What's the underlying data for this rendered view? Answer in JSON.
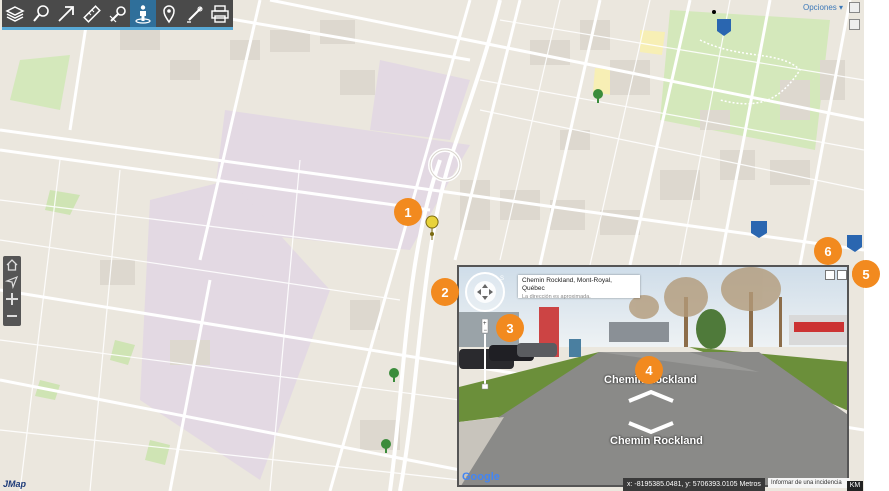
{
  "toolbar": {
    "tools": [
      {
        "icon": "layers-icon",
        "active": false
      },
      {
        "icon": "search-icon",
        "active": false
      },
      {
        "icon": "arrow-upright-icon",
        "active": false
      },
      {
        "icon": "measure-icon",
        "active": false
      },
      {
        "icon": "select-icon",
        "active": false
      },
      {
        "icon": "street-view-icon",
        "active": true
      },
      {
        "icon": "pin-icon",
        "active": false
      },
      {
        "icon": "draw-icon",
        "active": false
      },
      {
        "icon": "print-icon",
        "active": false
      }
    ]
  },
  "nav": {
    "items": [
      "home-icon",
      "locate-icon",
      "zoom-in-icon",
      "zoom-out-icon"
    ]
  },
  "options_label": "Opciones ▾",
  "brand": "JMap",
  "scale_unit": "KM",
  "status": {
    "coords": "x: -8195385.0481, y: 5706393.0105 Metros",
    "report": "Informar de una incidencia"
  },
  "streetview": {
    "address": "Chemin Rockland, Mont-Royal, Québec",
    "approx_note": "La dirección es aproximada.",
    "road_label_far": "Chemin Rockland",
    "road_label_near": "Chemin Rockland",
    "google_logo": "Google"
  },
  "callouts": [
    "1",
    "2",
    "3",
    "4",
    "5",
    "6"
  ],
  "colors": {
    "accent": "#58a9d6",
    "callout": "#f28a1f",
    "toolbar_bg": "#4a4a4a",
    "map_bg": "#ebe7de"
  }
}
